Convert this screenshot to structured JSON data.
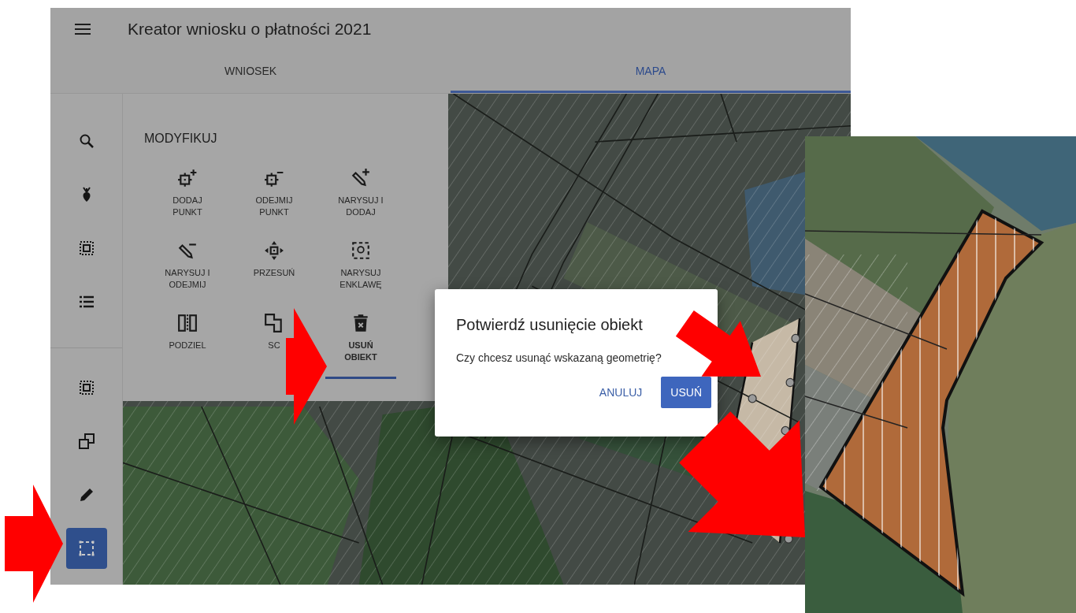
{
  "header": {
    "title": "Kreator wniosku o płatności 2021"
  },
  "tabs": [
    {
      "label": "WNIOSEK",
      "selected": false
    },
    {
      "label": "MAPA",
      "selected": true
    }
  ],
  "rail": {
    "top": [
      {
        "selected": false
      },
      {
        "selected": false
      },
      {
        "selected": false
      },
      {
        "selected": false
      }
    ],
    "bottom": [
      {
        "selected": false
      },
      {
        "selected": false
      },
      {
        "selected": false
      },
      {
        "selected": true
      }
    ]
  },
  "panel": {
    "title": "MODYFIKUJ",
    "tools": [
      {
        "label": "DODAJ PUNKT",
        "selected": false
      },
      {
        "label": "ODEJMIJ PUNKT",
        "selected": false
      },
      {
        "label": "NARYSUJ I DODAJ",
        "selected": false
      },
      {
        "label": "NARYSUJ I ODEJMIJ",
        "selected": false
      },
      {
        "label": "PRZESUŃ",
        "selected": false
      },
      {
        "label": "NARYSUJ ENKLAWĘ",
        "selected": false
      },
      {
        "label": "PODZIEL",
        "selected": false
      },
      {
        "label": "SC",
        "selected": false
      },
      {
        "label": "USUŃ OBIEKT",
        "selected": true
      }
    ]
  },
  "dialog": {
    "title": "Potwierdź usunięcie obiekt",
    "message": "Czy chcesz usunąć wskazaną geometrię?",
    "buttons": [
      {
        "label": "ANULUJ",
        "kind": "text"
      },
      {
        "label": "USUŃ",
        "kind": "primary"
      }
    ]
  }
}
